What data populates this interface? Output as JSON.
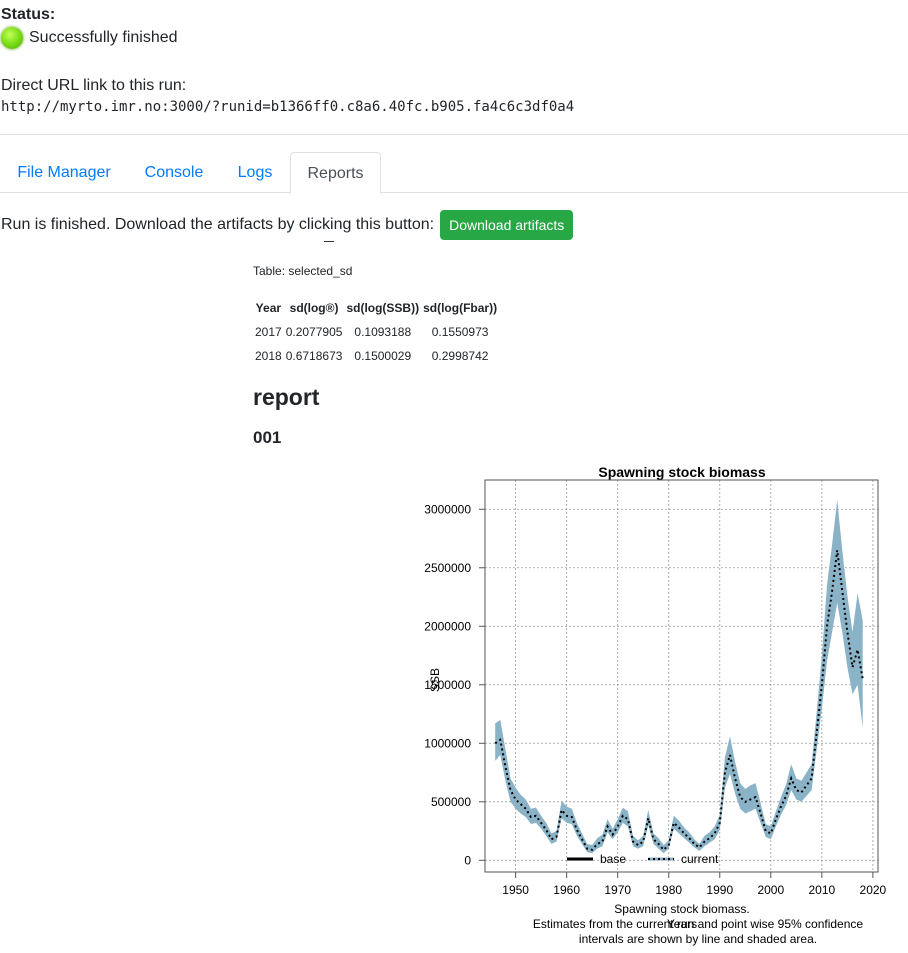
{
  "status": {
    "label": "Status:",
    "text": "Successfully finished",
    "led_color": "#7fe01a"
  },
  "run": {
    "url_label": "Direct URL link to this run:",
    "url": "http://myrto.imr.no:3000/?runid=b1366ff0.c8a6.40fc.b905.fa4c6c3df0a4"
  },
  "tabs": [
    {
      "label": "File Manager",
      "active": false
    },
    {
      "label": "Console",
      "active": false
    },
    {
      "label": "Logs",
      "active": false
    },
    {
      "label": "Reports",
      "active": true
    }
  ],
  "download": {
    "text": "Run is finished. Download the artifacts by clicking this button:",
    "button_label": "Download artifacts",
    "button_color": "#28a745"
  },
  "table": {
    "caption": "Table: selected_sd",
    "headers": [
      "Year",
      "sd(log®)",
      "sd(log(SSB))",
      "sd(log(Fbar))"
    ],
    "rows": [
      [
        "2017",
        "0.2077905",
        "0.1093188",
        "0.1550973"
      ],
      [
        "2018",
        "0.6718673",
        "0.1500029",
        "0.2998742"
      ]
    ]
  },
  "report": {
    "heading": "report",
    "subheading": "001"
  },
  "chart_data": {
    "type": "line",
    "title": "Spawning stock biomass",
    "ylabel": "SSB",
    "xlabel": "Years",
    "xlim": [
      1944,
      2021
    ],
    "ylim": [
      -100000,
      3250000
    ],
    "xticks": [
      1950,
      1960,
      1970,
      1980,
      1990,
      2000,
      2010,
      2020
    ],
    "yticks": [
      0,
      500000,
      1000000,
      1500000,
      2000000,
      2500000,
      3000000
    ],
    "ytick_labels": [
      "0",
      "500000",
      "1000000",
      "1500000",
      "2000000",
      "2500000",
      "3000000"
    ],
    "grid": true,
    "legend": [
      "base",
      "current"
    ],
    "legend_position": "bottom",
    "caption_lines": [
      "Spawning stock biomass.",
      "Estimates from the current run and point wise 95% confidence",
      "intervals are shown by line and shaded area."
    ],
    "band_color": "#8ab3c7",
    "line_color": "#000000",
    "series": [
      {
        "name": "current",
        "x": [
          1946,
          1947,
          1948,
          1949,
          1950,
          1951,
          1952,
          1953,
          1954,
          1955,
          1956,
          1957,
          1958,
          1959,
          1960,
          1961,
          1962,
          1963,
          1964,
          1965,
          1966,
          1967,
          1968,
          1969,
          1970,
          1971,
          1972,
          1973,
          1974,
          1975,
          1976,
          1977,
          1978,
          1979,
          1980,
          1981,
          1982,
          1983,
          1984,
          1985,
          1986,
          1987,
          1988,
          1989,
          1990,
          1991,
          1992,
          1993,
          1994,
          1995,
          1996,
          1997,
          1998,
          1999,
          2000,
          2001,
          2002,
          2003,
          2004,
          2005,
          2006,
          2007,
          2008,
          2009,
          2010,
          2011,
          2012,
          2013,
          2014,
          2015,
          2016,
          2017,
          2018
        ],
        "values": [
          1000000,
          1030000,
          800000,
          600000,
          520000,
          480000,
          440000,
          370000,
          380000,
          320000,
          260000,
          180000,
          200000,
          430000,
          380000,
          370000,
          260000,
          180000,
          100000,
          90000,
          140000,
          160000,
          290000,
          220000,
          290000,
          380000,
          350000,
          160000,
          130000,
          160000,
          360000,
          180000,
          140000,
          90000,
          130000,
          320000,
          280000,
          230000,
          190000,
          140000,
          110000,
          160000,
          190000,
          230000,
          320000,
          750000,
          900000,
          700000,
          540000,
          500000,
          520000,
          540000,
          400000,
          250000,
          230000,
          350000,
          460000,
          550000,
          700000,
          600000,
          580000,
          640000,
          700000,
          1100000,
          1500000,
          2000000,
          2300000,
          2650000,
          2300000,
          1950000,
          1650000,
          1800000,
          1550000
        ],
        "lower": [
          850000,
          900000,
          680000,
          500000,
          440000,
          400000,
          370000,
          310000,
          320000,
          270000,
          210000,
          140000,
          160000,
          360000,
          320000,
          310000,
          210000,
          140000,
          70000,
          60000,
          100000,
          120000,
          240000,
          180000,
          240000,
          320000,
          290000,
          120000,
          100000,
          120000,
          300000,
          140000,
          100000,
          60000,
          100000,
          270000,
          230000,
          190000,
          150000,
          110000,
          80000,
          120000,
          150000,
          180000,
          260000,
          620000,
          740000,
          570000,
          440000,
          400000,
          420000,
          440000,
          320000,
          200000,
          180000,
          290000,
          390000,
          470000,
          600000,
          520000,
          500000,
          550000,
          600000,
          950000,
          1300000,
          1700000,
          1950000,
          2200000,
          1950000,
          1650000,
          1420000,
          1500000,
          1130000
        ],
        "upper": [
          1170000,
          1200000,
          950000,
          700000,
          620000,
          560000,
          520000,
          440000,
          450000,
          380000,
          320000,
          230000,
          250000,
          510000,
          460000,
          440000,
          320000,
          230000,
          140000,
          130000,
          190000,
          220000,
          350000,
          270000,
          350000,
          450000,
          420000,
          210000,
          170000,
          210000,
          430000,
          230000,
          190000,
          130000,
          170000,
          380000,
          340000,
          280000,
          240000,
          180000,
          140000,
          210000,
          240000,
          290000,
          390000,
          880000,
          1060000,
          840000,
          660000,
          610000,
          640000,
          660000,
          490000,
          310000,
          290000,
          420000,
          540000,
          650000,
          820000,
          700000,
          680000,
          750000,
          820000,
          1280000,
          1750000,
          2350000,
          2700000,
          3080000,
          2650000,
          2260000,
          1950000,
          2280000,
          2050000
        ]
      }
    ]
  }
}
